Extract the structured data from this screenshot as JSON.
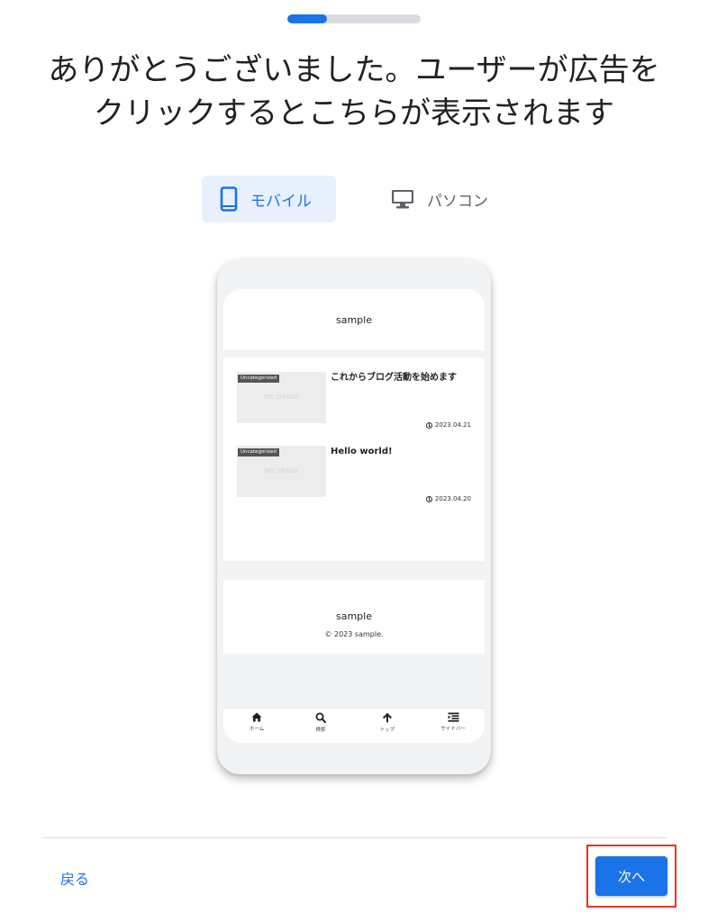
{
  "progress": {
    "value_percent": 30
  },
  "headline": {
    "line1": "ありがとうございました。ユーザーが広告を",
    "line2": "クリックするとこちらが表示されます"
  },
  "device_toggle": {
    "mobile_label": "モバイル",
    "desktop_label": "パソコン",
    "selected": "モバイル"
  },
  "preview": {
    "site_name": "sample",
    "posts": [
      {
        "category": "Uncategorized",
        "placeholder": "NO IMAGE",
        "title": "これからブログ活動を始めます",
        "date": "2023.04.21"
      },
      {
        "category": "Uncategorized",
        "placeholder": "NO IMAGE",
        "title": "Hello world!",
        "date": "2023.04.20"
      }
    ],
    "footer_name": "sample",
    "copyright": "© 2023 sample.",
    "nav": [
      {
        "label": "ホーム",
        "icon": "home-icon"
      },
      {
        "label": "検索",
        "icon": "search-icon"
      },
      {
        "label": "トップ",
        "icon": "arrow-up-icon"
      },
      {
        "label": "サイドバー",
        "icon": "sidebar-icon"
      }
    ]
  },
  "footer": {
    "back_label": "戻る",
    "next_label": "次へ"
  },
  "colors": {
    "accent": "#1a73e8",
    "highlight_border": "#e8341c",
    "toggle_selected_bg": "#e8f0fe"
  }
}
